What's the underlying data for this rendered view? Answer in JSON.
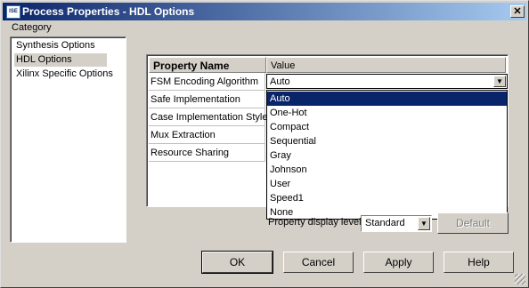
{
  "window": {
    "title": "Process Properties - HDL Options",
    "icon": "ise-app-icon",
    "close_label": "✕"
  },
  "category": {
    "label": "Category",
    "items": [
      "Synthesis Options",
      "HDL Options",
      "Xilinx Specific Options"
    ],
    "selected": "HDL Options"
  },
  "grid": {
    "headers": {
      "name": "Property Name",
      "value": "Value"
    },
    "rows": [
      {
        "name": "FSM Encoding Algorithm",
        "value": "Auto"
      },
      {
        "name": "Safe Implementation"
      },
      {
        "name": "Case Implementation Style"
      },
      {
        "name": "Mux Extraction"
      },
      {
        "name": "Resource Sharing"
      }
    ]
  },
  "dropdown": {
    "options": [
      "Auto",
      "One-Hot",
      "Compact",
      "Sequential",
      "Gray",
      "Johnson",
      "User",
      "Speed1",
      "None"
    ],
    "selected": "Auto"
  },
  "display_level": {
    "label": "Property display level:",
    "value": "Standard"
  },
  "buttons": {
    "default": "Default",
    "ok": "OK",
    "cancel": "Cancel",
    "apply": "Apply",
    "help": "Help"
  },
  "colors": {
    "title_start": "#0a246a",
    "title_end": "#a6caf0",
    "selection": "#0a246a",
    "face": "#d4d0c8"
  }
}
